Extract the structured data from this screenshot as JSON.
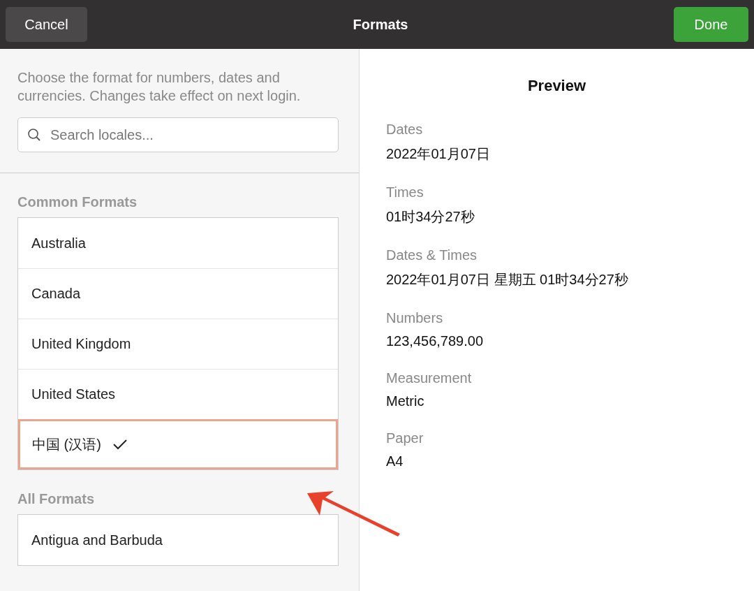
{
  "header": {
    "cancel": "Cancel",
    "title": "Formats",
    "done": "Done"
  },
  "description": "Choose the format for numbers, dates and currencies. Changes take effect on next login.",
  "search": {
    "placeholder": "Search locales..."
  },
  "common_formats": {
    "heading": "Common Formats",
    "items": [
      {
        "label": "Australia",
        "selected": false
      },
      {
        "label": "Canada",
        "selected": false
      },
      {
        "label": "United Kingdom",
        "selected": false
      },
      {
        "label": "United States",
        "selected": false
      },
      {
        "label": "中国 (汉语)",
        "selected": true
      }
    ]
  },
  "all_formats": {
    "heading": "All Formats",
    "items": [
      {
        "label": "Antigua and Barbuda",
        "selected": false
      }
    ]
  },
  "preview": {
    "title": "Preview",
    "fields": [
      {
        "label": "Dates",
        "value": "2022年01月07日"
      },
      {
        "label": "Times",
        "value": "01时34分27秒"
      },
      {
        "label": "Dates & Times",
        "value": "2022年01月07日 星期五 01时34分27秒"
      },
      {
        "label": "Numbers",
        "value": "123,456,789.00"
      },
      {
        "label": "Measurement",
        "value": "Metric"
      },
      {
        "label": "Paper",
        "value": "A4"
      }
    ]
  }
}
